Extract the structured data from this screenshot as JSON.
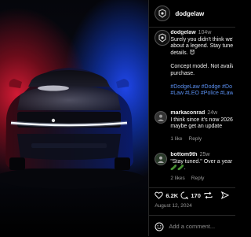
{
  "post": {
    "username": "dodgelaw",
    "timestamp": "104w",
    "caption_lines": [
      "Surely you didn't think we'",
      "about a legend. Stay tuned",
      "details. 😈",
      "",
      "Concept model. Not availab",
      "purchase."
    ],
    "hashtag_lines": [
      "#DodgeLaw #Dodge #Do",
      "#Law #LEO #Police #LawEn"
    ],
    "date": "August 12, 2024"
  },
  "comments": [
    {
      "username": "markaconrad",
      "timestamp": "24w",
      "text_lines": [
        "I think since it's now 2026",
        "maybe get an update"
      ],
      "likes": "1 like",
      "reply": "Reply"
    },
    {
      "username": "bottom9th",
      "timestamp": "25w",
      "text_lines": [
        "\"Stay tuned.\" Over a year l",
        "🥒🥒."
      ],
      "likes": "2 likes",
      "reply": "Reply"
    }
  ],
  "actions": {
    "likes_count": "6.2K",
    "comments_count": "170"
  },
  "comment_input": {
    "placeholder": "Add a comment..."
  },
  "colors": {
    "accent_blue": "#5a8ff0",
    "muted": "#9a9a9a",
    "divider": "#262626"
  }
}
